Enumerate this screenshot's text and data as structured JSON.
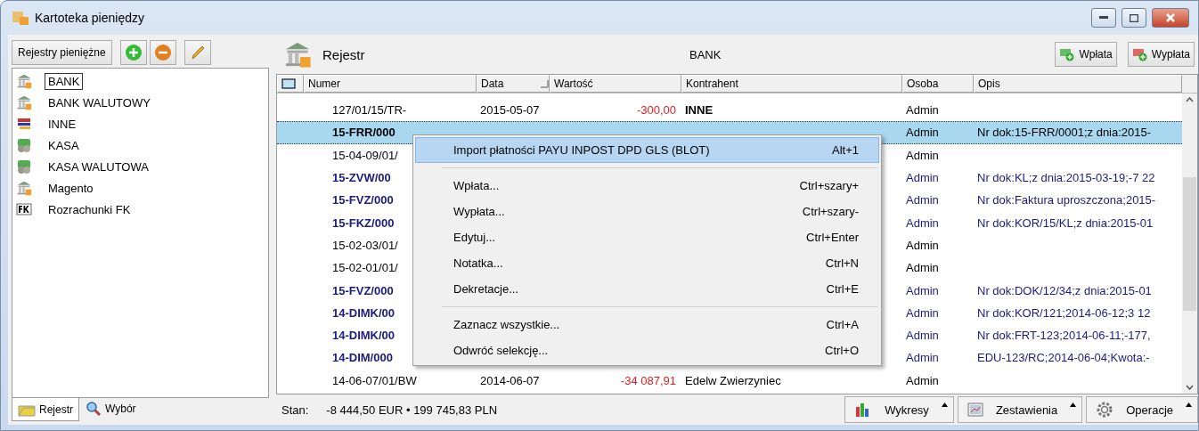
{
  "window": {
    "title": "Kartoteka pieniędzy"
  },
  "sidebar": {
    "header_button": "Rejestry pieniężne",
    "items": [
      {
        "label": "BANK",
        "kind": "bank",
        "selected": true
      },
      {
        "label": "BANK WALUTOWY",
        "kind": "bank",
        "selected": false
      },
      {
        "label": "INNE",
        "kind": "other",
        "selected": false
      },
      {
        "label": "KASA",
        "kind": "cash",
        "selected": false
      },
      {
        "label": "KASA WALUTOWA",
        "kind": "cash",
        "selected": false
      },
      {
        "label": "Magento",
        "kind": "bank",
        "selected": false
      },
      {
        "label": "Rozrachunki FK",
        "kind": "fk",
        "selected": false
      }
    ],
    "tabs": [
      {
        "label": "Rejestr",
        "selected": true
      },
      {
        "label": "Wybór",
        "selected": false
      }
    ]
  },
  "register": {
    "title": "Rejestr",
    "name": "BANK",
    "buttons": [
      {
        "label": "Wpłata",
        "kind": "in"
      },
      {
        "label": "Wypłata",
        "kind": "out"
      }
    ]
  },
  "table": {
    "columns": [
      "Numer",
      "Data",
      "Wartość",
      "Kontrahent",
      "Osoba",
      "Opis"
    ],
    "rows": [
      {
        "kind": "plain",
        "selected": false,
        "numer": "127/01/15/TR-",
        "data": "2015-05-07",
        "wartosc": "-300,00",
        "kontrahent": "INNE",
        "kontrahent_bold": true,
        "osoba": "Admin",
        "opis": ""
      },
      {
        "kind": "document",
        "selected": true,
        "numer": "15-FRR/000",
        "osoba": "Admin",
        "opis": "Nr dok:15-FRR/0001;z dnia:2015-"
      },
      {
        "kind": "plain",
        "selected": false,
        "numer": "15-04-09/01/",
        "osoba": "Admin",
        "opis": ""
      },
      {
        "kind": "document",
        "selected": false,
        "numer": "15-ZVW/00",
        "osoba": "Admin",
        "opis": "Nr dok:KL;z dnia:2015-03-19;-7 22"
      },
      {
        "kind": "document",
        "selected": false,
        "numer": "15-FVZ/000",
        "osoba": "Admin",
        "opis": "Nr dok:Faktura uproszczona;2015-"
      },
      {
        "kind": "document",
        "selected": false,
        "numer": "15-FKZ/000",
        "osoba": "Admin",
        "opis": "Nr dok:KOR/15/KL;z dnia:2015-01"
      },
      {
        "kind": "plain",
        "selected": false,
        "numer": "15-02-03/01/",
        "osoba": "Admin",
        "opis": ""
      },
      {
        "kind": "plain",
        "selected": false,
        "numer": "15-02-01/01/",
        "osoba": "Admin",
        "opis": ""
      },
      {
        "kind": "document",
        "selected": false,
        "numer": "15-FVZ/000",
        "osoba": "Admin",
        "opis": "Nr dok:DOK/12/34;z dnia:2015-01"
      },
      {
        "kind": "document",
        "selected": false,
        "numer": "14-DIMK/00",
        "osoba": "Admin",
        "opis": "Nr dok:KOR/121;2014-06-12;3 12"
      },
      {
        "kind": "document",
        "selected": false,
        "numer": "14-DIMK/00",
        "osoba": "Admin",
        "opis": "Nr dok:FRT-123;2014-06-11;-177,"
      },
      {
        "kind": "document",
        "selected": false,
        "numer": "14-DIM/000",
        "osoba": "Admin",
        "opis": "EDU-123/RC;2014-06-04;Kwota:-"
      },
      {
        "kind": "plain",
        "selected": false,
        "numer": "14-06-07/01/BW",
        "data": "2014-06-07",
        "wartosc": "-34 087,91",
        "kontrahent": "Edelw Zwierzyniec",
        "kontrahent_bold": false,
        "osoba": "Admin",
        "opis": ""
      }
    ]
  },
  "context_menu": {
    "items": [
      {
        "kind": "item",
        "label": "Import płatności PAYU INPOST DPD GLS (BLOT)",
        "shortcut": "Alt+1",
        "selected": true
      },
      {
        "kind": "separator"
      },
      {
        "kind": "item",
        "label": "Wpłata...",
        "shortcut": "Ctrl+szary+",
        "selected": false
      },
      {
        "kind": "item",
        "label": "Wypłata...",
        "shortcut": "Ctrl+szary-",
        "selected": false
      },
      {
        "kind": "item",
        "label": "Edytuj...",
        "shortcut": "Ctrl+Enter",
        "selected": false
      },
      {
        "kind": "item",
        "label": "Notatka...",
        "shortcut": "Ctrl+N",
        "selected": false
      },
      {
        "kind": "item",
        "label": "Dekretacje...",
        "shortcut": "Ctrl+E",
        "selected": false
      },
      {
        "kind": "separator"
      },
      {
        "kind": "item",
        "label": "Zaznacz wszystkie...",
        "shortcut": "Ctrl+A",
        "selected": false
      },
      {
        "kind": "item",
        "label": "Odwróć selekcję...",
        "shortcut": "Ctrl+O",
        "selected": false
      }
    ]
  },
  "status_bar": {
    "label": "Stan:",
    "value": "-8 444,50 EUR • 199 745,83 PLN",
    "buttons": [
      {
        "label": "Wykresy",
        "kind": "chart"
      },
      {
        "label": "Zestawienia",
        "kind": "report"
      },
      {
        "label": "Operacje",
        "kind": "gear"
      }
    ]
  }
}
